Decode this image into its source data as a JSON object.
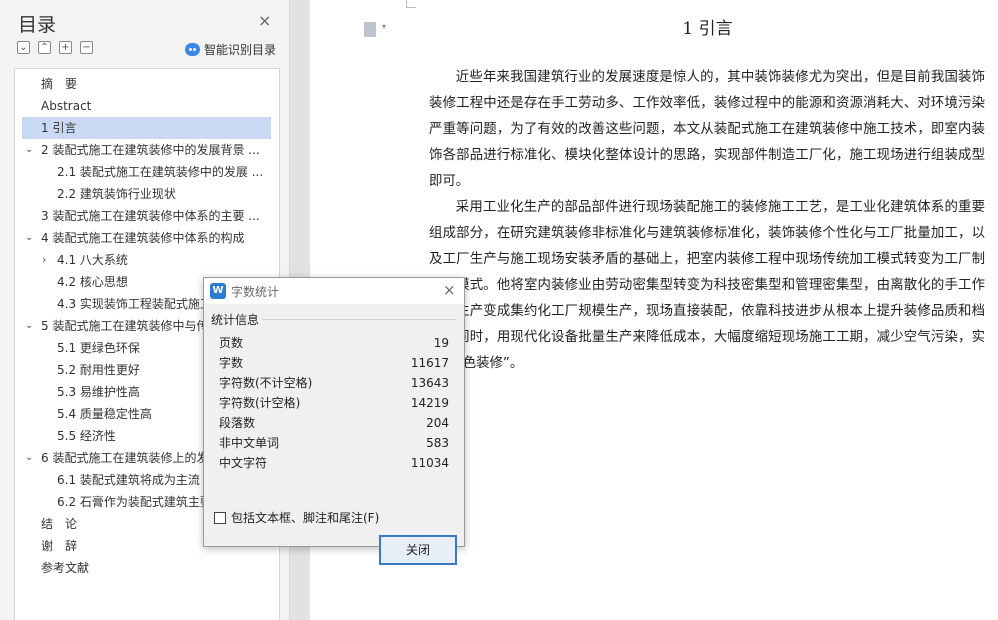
{
  "toc": {
    "title": "目录",
    "close_icon": "×",
    "smart_label": "智能识别目录",
    "tools": [
      "⌄",
      "⌃",
      "+",
      "−"
    ],
    "items": [
      {
        "label": "摘　要",
        "level": 1,
        "caret": ""
      },
      {
        "label": "Abstract",
        "level": 1,
        "caret": ""
      },
      {
        "label": "1 引言",
        "level": 1,
        "caret": "",
        "selected": true
      },
      {
        "label": "2 装配式施工在建筑装修中的发展背景 ...",
        "level": 1,
        "caret": "⌄"
      },
      {
        "label": "2.1 装配式施工在建筑装修中的发展 ...",
        "level": 2,
        "caret": ""
      },
      {
        "label": "2.2 建筑装饰行业现状",
        "level": 2,
        "caret": ""
      },
      {
        "label": "3 装配式施工在建筑装修中体系的主要 ...",
        "level": 1,
        "caret": ""
      },
      {
        "label": "4 装配式施工在建筑装修中体系的构成",
        "level": 1,
        "caret": "⌄"
      },
      {
        "label": "4.1 八大系统",
        "level": 2,
        "caret": "›"
      },
      {
        "label": "4.2 核心思想",
        "level": 2,
        "caret": ""
      },
      {
        "label": "4.3 实现装饰工程装配式施工",
        "level": 2,
        "caret": ""
      },
      {
        "label": "5 装配式施工在建筑装修中与传统",
        "level": 1,
        "caret": "⌄"
      },
      {
        "label": "5.1 更绿色环保",
        "level": 2,
        "caret": ""
      },
      {
        "label": "5.2 耐用性更好",
        "level": 2,
        "caret": ""
      },
      {
        "label": "5.3 易维护性高",
        "level": 2,
        "caret": ""
      },
      {
        "label": "5.4 质量稳定性高",
        "level": 2,
        "caret": ""
      },
      {
        "label": "5.5 经济性",
        "level": 2,
        "caret": ""
      },
      {
        "label": "6 装配式施工在建筑装修上的发",
        "level": 1,
        "caret": "⌄"
      },
      {
        "label": "6.1 装配式建筑将成为主流",
        "level": 2,
        "caret": ""
      },
      {
        "label": "6.2 石膏作为装配式建筑主要",
        "level": 2,
        "caret": ""
      },
      {
        "label": "结　论",
        "level": 1,
        "caret": ""
      },
      {
        "label": "谢　辞",
        "level": 1,
        "caret": ""
      },
      {
        "label": "参考文献",
        "level": 1,
        "caret": ""
      }
    ]
  },
  "document": {
    "heading": "1 引言",
    "paragraphs": [
      "近些年来我国建筑行业的发展速度是惊人的，其中装饰装修尤为突出，但是目前我国装饰装修工程中还是存在手工劳动多、工作效率低，装修过程中的能源和资源消耗大、对环境污染严重等问题，为了有效的改善这些问题，本文从装配式施工在建筑装修中施工技术，即室内装饰各部品进行标准化、模块化整体设计的思路，实现部件制造工厂化，施工现场进行组装成型即可。",
      "采用工业化生产的部品部件进行现场装配施工的装修施工工艺，是工业化建筑体系的重要组成部分，在研究建筑装修非标准化与建筑装修标准化，装饰装修个性化与工厂批量加工，以及工厂生产与施工现场安装矛盾的基础上，把室内装修工程中现场传统加工模式转变为工厂制加工模式。他将室内装修业由劳动密集型转变为科技密集型和管理密集型，由离散化的手工作坊式生产变成集约化工厂规模生产，现场直接装配，依靠科技进步从根本上提升装修品质和档次；同时，用现代化设备批量生产来降低成本，大幅度缩短现场施工工期，减少空气污染，实现“绿色装修”。"
    ]
  },
  "dialog": {
    "app_icon": "W",
    "title": "字数统计",
    "close_icon": "×",
    "section": "统计信息",
    "stats": [
      {
        "label": "页数",
        "value": "19"
      },
      {
        "label": "字数",
        "value": "11617"
      },
      {
        "label": "字符数(不计空格)",
        "value": "13643"
      },
      {
        "label": "字符数(计空格)",
        "value": "14219"
      },
      {
        "label": "段落数",
        "value": "204"
      },
      {
        "label": "非中文单词",
        "value": "583"
      },
      {
        "label": "中文字符",
        "value": "11034"
      }
    ],
    "checkbox_label": "包括文本框、脚注和尾注(F)",
    "close_button": "关闭"
  }
}
